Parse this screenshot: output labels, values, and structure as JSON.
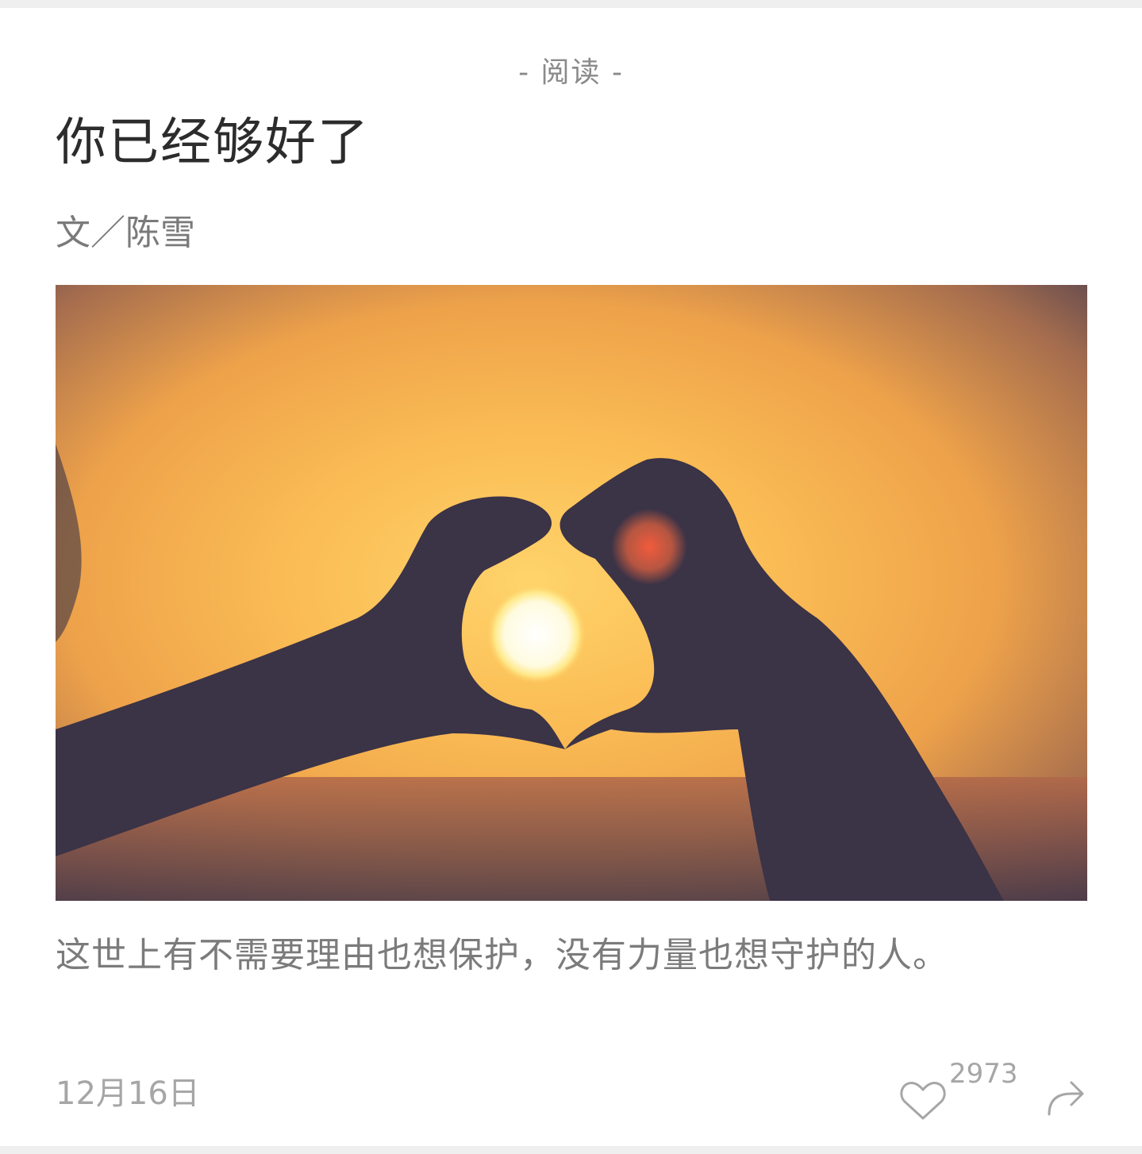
{
  "header": {
    "section_label": "- 阅读 -"
  },
  "article": {
    "title": "你已经够好了",
    "author": "文／陈雪",
    "cover_image": {
      "icon": "heart-hands-sunset-photo",
      "colors": {
        "sky_top": "#f6b04a",
        "sky_bottom": "#e89a3c",
        "silhouette": "#3b3346",
        "sun": "#fffbe6"
      }
    },
    "excerpt": "这世上有不需要理由也想保护，没有力量也想守护的人。"
  },
  "footer": {
    "date": "12月16日",
    "like_count": "2973",
    "like_icon": "heart-outline-icon",
    "share_icon": "share-arrow-icon"
  }
}
